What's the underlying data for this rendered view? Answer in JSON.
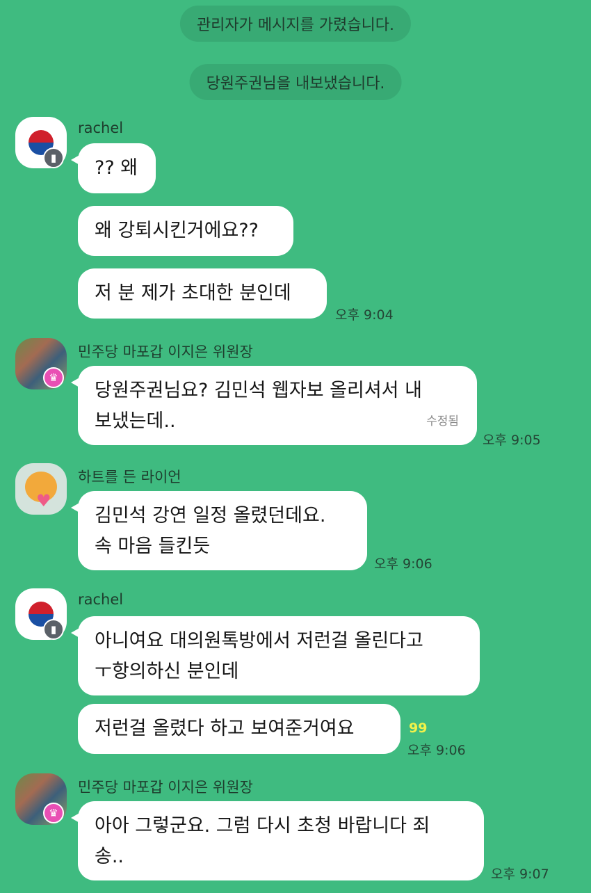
{
  "system_messages": [
    "관리자가 메시지를 가렸습니다.",
    "당원주권님을 내보냈습니다."
  ],
  "messages": [
    {
      "sender": "rachel",
      "avatar_icon": "korean-flag-icon",
      "badge_icon": "manager-badge-icon",
      "bubbles": [
        "?? 왜",
        "왜 강퇴시킨거에요??",
        "저 분 제가 초대한 분인데"
      ],
      "time": "오후 9:04"
    },
    {
      "sender": "민주당 마포갑 이지은 위원장",
      "avatar_icon": "profile-photo-icon",
      "badge_icon": "crown-icon",
      "bubbles": [
        {
          "line1": "당원주권님요? 김민석 웹자보 올리셔서 내",
          "line2": "보냈는데..",
          "edited": "수정됨"
        }
      ],
      "time": "오후 9:05"
    },
    {
      "sender": "하트를 든 라이언",
      "avatar_icon": "ryan-character-icon",
      "bubbles": [
        {
          "line1": "김민석 강연 일정 올렸던데요.",
          "line2": "속 마음 들킨듯"
        }
      ],
      "time": "오후 9:06"
    },
    {
      "sender": "rachel",
      "avatar_icon": "korean-flag-icon",
      "badge_icon": "manager-badge-icon",
      "bubbles": [
        {
          "line1": "아니여요 대의원톡방에서 저런걸 올린다고",
          "line2": "ㅜ항의하신 분인데"
        },
        "저런걸 올렸다 하고 보여준거여요"
      ],
      "unread": "99",
      "time": "오후 9:06"
    },
    {
      "sender": "민주당 마포갑 이지은 위원장",
      "avatar_icon": "profile-photo-icon",
      "badge_icon": "crown-icon",
      "bubbles": [
        {
          "line1": "아아 그렇군요. 그럼 다시 초청 바랍니다 죄",
          "line2": "송.."
        }
      ],
      "time": "오후 9:07"
    }
  ],
  "colors": {
    "background": "#3fbb80",
    "bubble": "#ffffff",
    "unread": "#f1f24a"
  }
}
